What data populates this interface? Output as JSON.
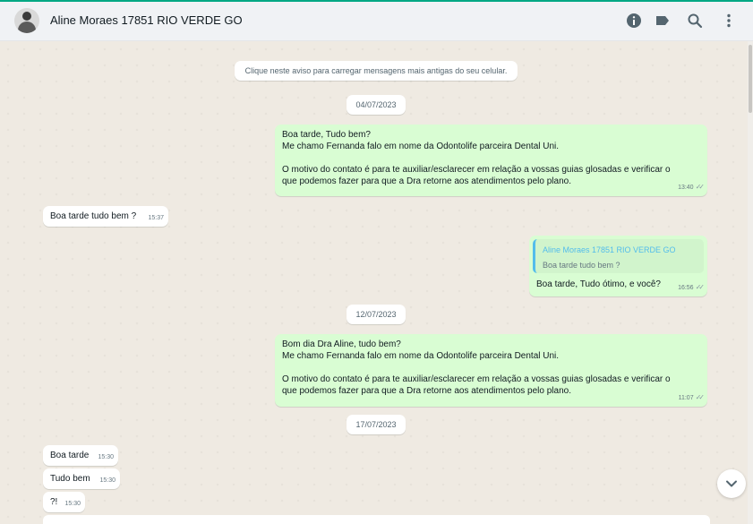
{
  "header": {
    "contact_name": "Aline Moraes 17851 RIO VERDE GO",
    "icons": [
      "info-icon",
      "label-icon",
      "search-icon",
      "menu-icon"
    ]
  },
  "system_notice": "Clique neste aviso para carregar mensagens mais antigas do seu celular.",
  "dates": [
    "04/07/2023",
    "12/07/2023",
    "17/07/2023"
  ],
  "messages": [
    {
      "direction": "out",
      "lines": [
        "Boa tarde, Tudo bem?",
        "Me chamo Fernanda falo em nome da Odontolife parceira Dental Uni.",
        "",
        "O motivo do contato é para te auxiliar/esclarecer em relação a vossas guias glosadas e verificar o",
        "que podemos fazer para que a Dra retorne aos atendimentos pelo plano."
      ],
      "time": "13:40"
    },
    {
      "direction": "in",
      "lines": [
        "Boa tarde tudo bem ?"
      ],
      "time": "15:37"
    },
    {
      "direction": "out",
      "quote": {
        "author": "Aline Moraes 17851 RIO VERDE GO",
        "text": "Boa tarde tudo bem ?"
      },
      "lines": [
        "Boa tarde, Tudo ótimo, e você?"
      ],
      "time": "16:56"
    },
    {
      "direction": "out",
      "lines": [
        "Bom dia Dra Aline, tudo bem?",
        "Me chamo Fernanda falo em nome da Odontolife parceira Dental Uni.",
        "",
        "O motivo do contato é para te auxiliar/esclarecer em relação a vossas guias glosadas e verificar o",
        "que podemos fazer para que a Dra retorne aos atendimentos pelo plano."
      ],
      "time": "11:07"
    },
    {
      "direction": "in",
      "lines": [
        "Boa tarde"
      ],
      "time": "15:30"
    },
    {
      "direction": "in",
      "lines": [
        "Tudo bem"
      ],
      "time": "15:30"
    },
    {
      "direction": "in",
      "lines": [
        "?!"
      ],
      "time": "15:30"
    }
  ],
  "colors": {
    "accent": "#00a884",
    "outgoing_bubble": "#d9fdd3",
    "incoming_bubble": "#ffffff",
    "quote_name": "#53bdeb"
  }
}
